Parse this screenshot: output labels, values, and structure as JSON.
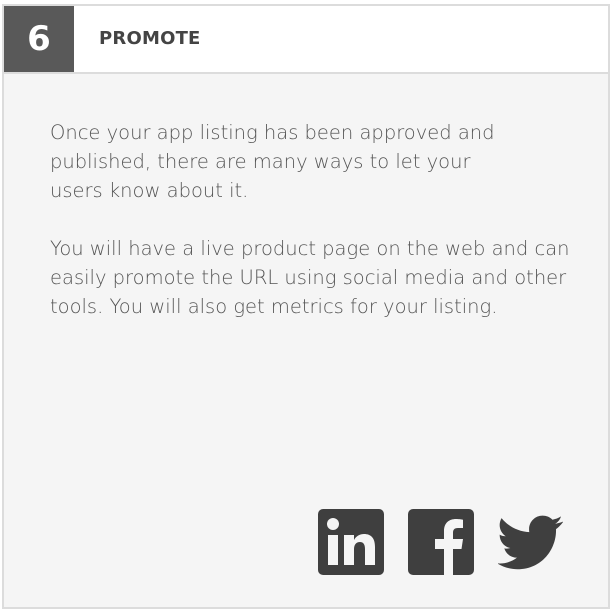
{
  "header": {
    "step_number": "6",
    "title": "PROMOTE"
  },
  "body": {
    "paragraphs": [
      "Once your app listing has been approved and published, there are many ways to let your users know about it.",
      "You will have a live product page on the web and can easily promote the URL using social media and other tools. You will also get metrics for your listing."
    ]
  },
  "social": {
    "icons": [
      "linkedin-icon",
      "facebook-icon",
      "twitter-icon"
    ]
  },
  "colors": {
    "badge_background": "#595959",
    "icon_color": "#3f3f3f",
    "card_background": "#f5f5f5",
    "border": "#dcdcdc",
    "text": "#555555"
  }
}
